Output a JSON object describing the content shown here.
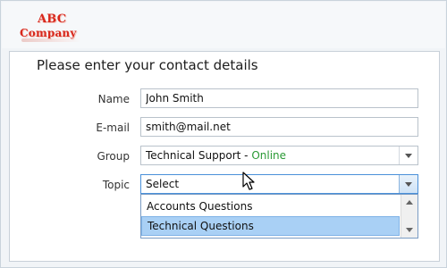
{
  "logo": {
    "line1": "ABC",
    "line2": "Company"
  },
  "form": {
    "title": "Please enter your contact details",
    "name": {
      "label": "Name",
      "value": "John Smith"
    },
    "email": {
      "label": "E-mail",
      "value": "smith@mail.net"
    },
    "group": {
      "label": "Group",
      "value": "Technical Support - ",
      "status": "Online",
      "status_color": "#2a9a35"
    },
    "topic": {
      "label": "Topic",
      "value": "Select",
      "options": [
        "Accounts Questions",
        "Technical Questions"
      ],
      "highlighted_index": 1
    }
  },
  "icons": {
    "dropdown_arrow": "chevron-down-icon",
    "scroll_up": "scroll-up-icon",
    "scroll_down": "scroll-down-icon",
    "cursor": "mouse-pointer-icon"
  },
  "colors": {
    "logo_red": "#d8281c",
    "highlight": "#a9d0f5",
    "focus_border": "#4a90d9"
  }
}
